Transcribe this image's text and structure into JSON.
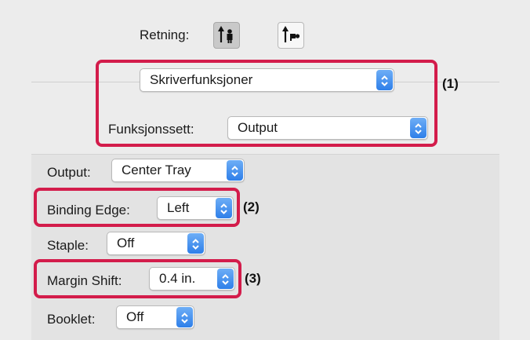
{
  "orientation": {
    "label": "Retning:",
    "options": [
      {
        "icon": "portrait-orientation-icon",
        "selected": true
      },
      {
        "icon": "landscape-orientation-icon",
        "selected": false
      }
    ]
  },
  "menu": {
    "selected": "Skriverfunksjoner"
  },
  "feature_set": {
    "label": "Funksjonssett:",
    "value": "Output"
  },
  "settings": {
    "output": {
      "label": "Output:",
      "value": "Center Tray"
    },
    "binding_edge": {
      "label": "Binding Edge:",
      "value": "Left"
    },
    "staple": {
      "label": "Staple:",
      "value": "Off"
    },
    "margin_shift": {
      "label": "Margin Shift:",
      "value": "0.4 in."
    },
    "booklet": {
      "label": "Booklet:",
      "value": "Off"
    }
  },
  "callouts": {
    "c1": "(1)",
    "c2": "(2)",
    "c3": "(3)"
  },
  "colors": {
    "highlight": "#d31c4b",
    "popup_accent": "#2e7fe9"
  }
}
